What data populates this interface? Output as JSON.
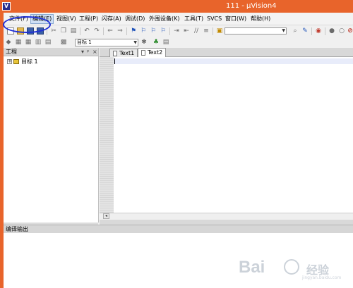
{
  "window": {
    "title": "111 - µVision4",
    "icon_label": "V"
  },
  "menubar": {
    "items": [
      {
        "label": "文件(F)"
      },
      {
        "label": "编辑(E)"
      },
      {
        "label": "视图(V)"
      },
      {
        "label": "工程(P)"
      },
      {
        "label": "闪存(A)"
      },
      {
        "label": "调试(D)"
      },
      {
        "label": "外围设备(K)"
      },
      {
        "label": "工具(T)"
      },
      {
        "label": "SVCS"
      },
      {
        "label": "窗口(W)"
      },
      {
        "label": "帮助(H)"
      }
    ]
  },
  "toolbar2": {
    "target_value": "目标 1"
  },
  "project_panel": {
    "title": "工程",
    "controls": [
      "▾",
      "ᵖ",
      "×"
    ],
    "tree": [
      {
        "expand": "+",
        "label": "目标 1"
      }
    ]
  },
  "editor": {
    "tabs": [
      {
        "label": "Text1"
      },
      {
        "label": "Text2"
      }
    ],
    "active_tab": "Text2",
    "scroll_left": "◂"
  },
  "output_panel": {
    "title": "编译输出"
  },
  "watermark": {
    "text": "Bai",
    "text2": "经验",
    "sub": "jingyan.baidu.com"
  },
  "colors": {
    "titlebar": "#e8642b",
    "highlight_ellipse": "#1f2fd6"
  },
  "icons": {
    "toolbar1": [
      "new-file-icon",
      "open-folder-icon",
      "save-icon",
      "save-all-icon",
      "cut-icon",
      "copy-icon",
      "paste-icon",
      "undo-icon",
      "redo-icon",
      "navigate-back-icon",
      "navigate-forward-icon",
      "bookmark-icon",
      "bookmark-prev-icon",
      "bookmark-next-icon",
      "bookmark-clear-icon",
      "indent-icon",
      "unindent-icon",
      "comment-icon",
      "uncomment-icon",
      "find-in-files-icon",
      "find-icon",
      "debug-icon",
      "breakpoint-icon"
    ],
    "toolbar2": [
      "build-icon",
      "rebuild-icon",
      "batch-build-icon",
      "download-icon",
      "target-options-icon",
      "manage-components-icon"
    ]
  }
}
